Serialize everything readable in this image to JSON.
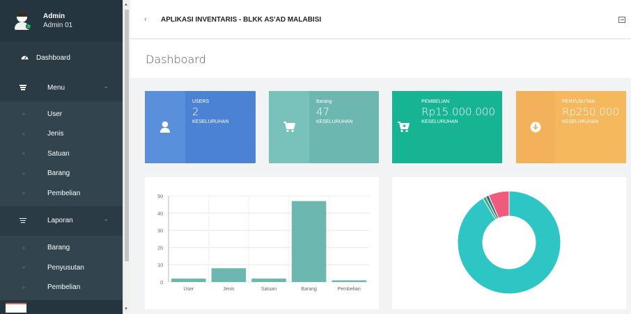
{
  "sidebar": {
    "user": {
      "name": "Admin",
      "subtitle": "Admin 01"
    },
    "dashboard_label": "Dashboard",
    "menu_label": "Menu",
    "menu_items": [
      "User",
      "Jenis",
      "Satuan",
      "Barang",
      "Pembelian"
    ],
    "laporan_label": "Laporan",
    "laporan_items": [
      "Barang",
      "Penyusutan",
      "Pembelian"
    ]
  },
  "header": {
    "back_icon": "chevron-left-icon",
    "title": "APLIKASI INVENTARIS - BLKK AS'AD MALABISI"
  },
  "page": {
    "title": "Dashboard"
  },
  "stats": [
    {
      "label": "USERS",
      "value": "2",
      "caption": "KESELURUHAN",
      "icon": "user-icon",
      "color": "#4b82d4",
      "icon_bg": "#5a8fdb"
    },
    {
      "label": "Barang",
      "value": "47",
      "caption": "KESELURUHAN",
      "icon": "cart-icon",
      "color": "#6cb8b1",
      "icon_bg": "#78c2bb"
    },
    {
      "label": "PEMBELIAN",
      "value": "Rp15.000.000",
      "caption": "KESELURUHAN",
      "icon": "cart-plus-icon",
      "color": "#16b493",
      "icon_bg": "#16b493"
    },
    {
      "label": "PENYUSUTAN",
      "value": "Rp250.000",
      "caption": "KESELURUHAN",
      "icon": "download-circle-icon",
      "color": "#f6b85c",
      "icon_bg": "#f2b15a"
    }
  ],
  "chart_data": [
    {
      "type": "bar",
      "categories": [
        "User",
        "Jenis",
        "Satuan",
        "Barang",
        "Pembelian"
      ],
      "values": [
        2,
        8,
        2,
        47,
        1
      ],
      "ylim": [
        0,
        50
      ],
      "yticks": [
        0,
        10,
        20,
        30,
        40,
        50
      ],
      "bar_color": "#6cb8b1",
      "grid": true
    },
    {
      "type": "pie",
      "donut": true,
      "slices": [
        {
          "value": 91.5,
          "color": "#2ec5c5"
        },
        {
          "value": 1.0,
          "color": "#3aaa6e"
        },
        {
          "value": 1.0,
          "color": "#2f6a8a"
        },
        {
          "value": 6.5,
          "color": "#ef5b7b"
        }
      ]
    }
  ]
}
